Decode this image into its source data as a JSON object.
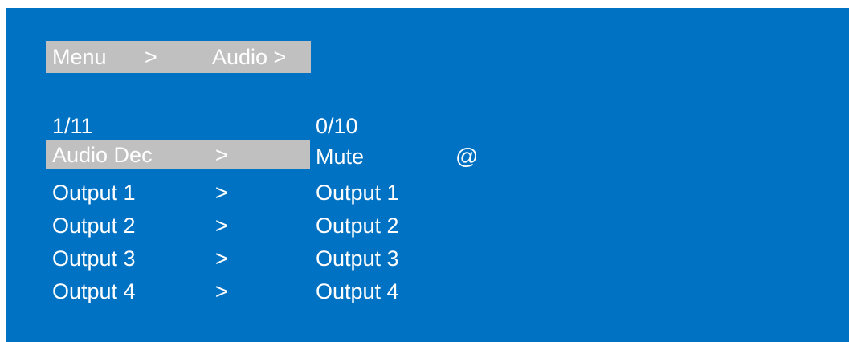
{
  "breadcrumb": {
    "root": "Menu",
    "sep": ">",
    "current": "Audio >"
  },
  "left_list": {
    "counter": "1/11",
    "items": [
      {
        "label": "Audio Dec",
        "arrow": ">",
        "selected": true
      },
      {
        "label": "Output 1",
        "arrow": ">"
      },
      {
        "label": "Output 2",
        "arrow": ">"
      },
      {
        "label": "Output 3",
        "arrow": ">"
      },
      {
        "label": "Output 4",
        "arrow": ">"
      }
    ]
  },
  "right_list": {
    "counter": "0/10",
    "items": [
      {
        "label": "Mute"
      },
      {
        "label": "Output 1"
      },
      {
        "label": "Output 2"
      },
      {
        "label": "Output 3"
      },
      {
        "label": "Output 4"
      }
    ]
  },
  "marker": "@",
  "colors": {
    "background": "#0072c3",
    "highlight": "#c0c0c0",
    "text": "#ffffff"
  }
}
